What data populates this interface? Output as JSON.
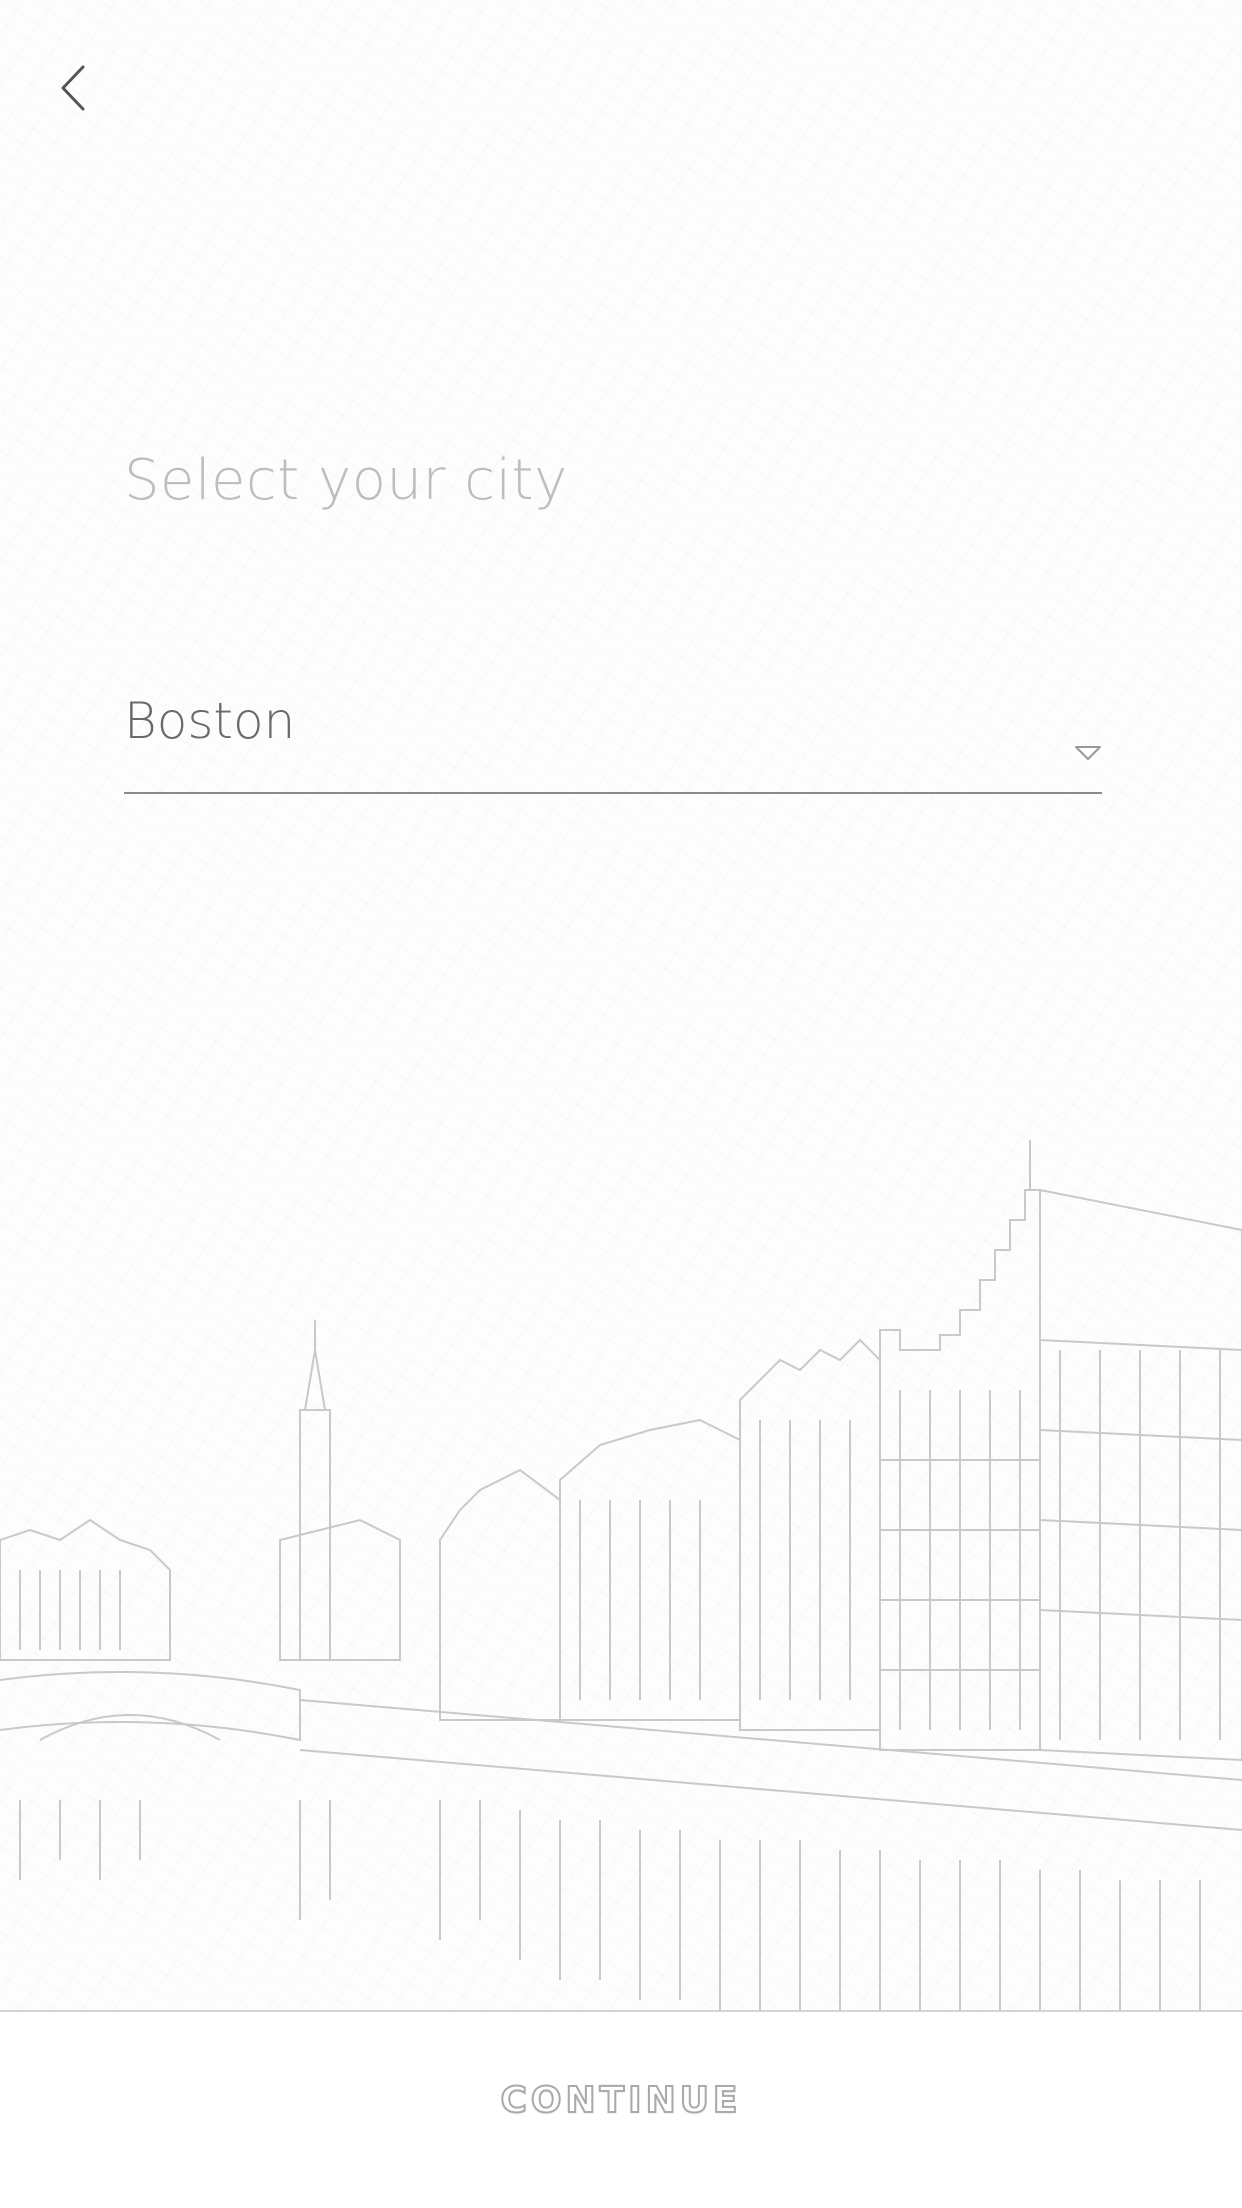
{
  "header": {
    "back_icon": "chevron-left-icon"
  },
  "main": {
    "title": "Select your city",
    "city_select": {
      "selected_value": "Boston",
      "arrow_icon": "caret-down-icon"
    }
  },
  "footer": {
    "continue_label": "CONTINUE"
  },
  "colors": {
    "title": "#bdbdbd",
    "select_text": "#6a6a6a",
    "underline": "#8a8a8a",
    "sketch_line": "#c8c8c8"
  }
}
